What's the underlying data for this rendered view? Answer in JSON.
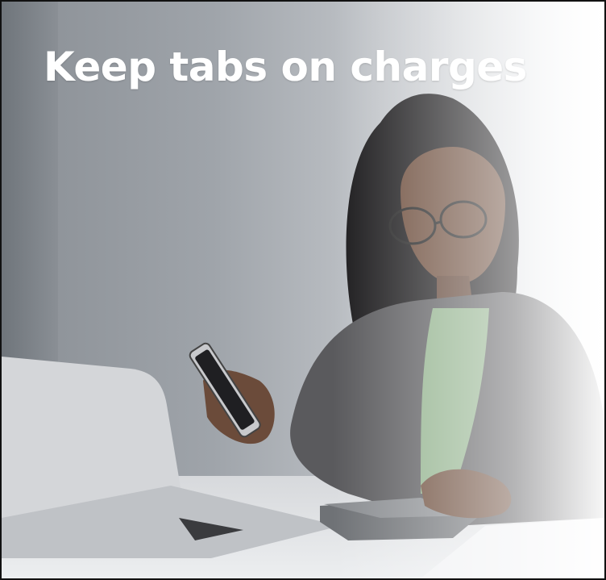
{
  "headline": "Keep tabs on charges",
  "image": {
    "subject": "woman-using-phone-and-calculator-at-desk-with-laptop"
  },
  "colors": {
    "text": "#ffffff",
    "overlay_fade_to": "#fbfbfc",
    "wall": "#9fa4aa"
  }
}
